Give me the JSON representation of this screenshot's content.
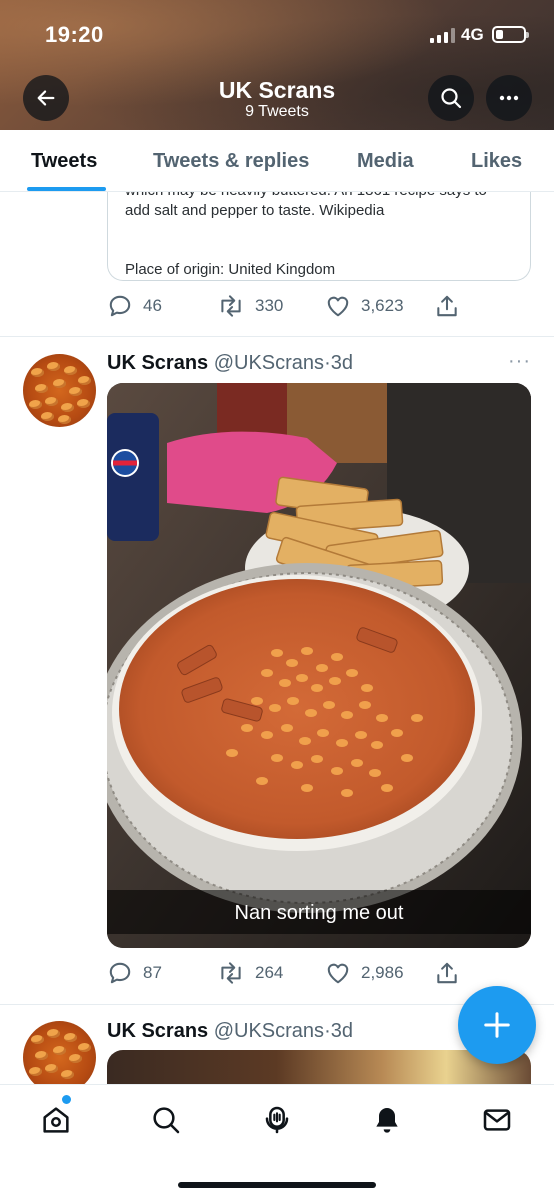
{
  "status_bar": {
    "time": "19:20",
    "network": "4G"
  },
  "header": {
    "title": "UK Scrans",
    "subtitle": "9 Tweets"
  },
  "tabs": [
    {
      "label": "Tweets",
      "active": true
    },
    {
      "label": "Tweets & replies",
      "active": false
    },
    {
      "label": "Media",
      "active": false
    },
    {
      "label": "Likes",
      "active": false
    }
  ],
  "tweet1": {
    "card": {
      "line1": "which may be heavily buttered. An 1861 recipe says to",
      "line2": "add salt and pepper to taste. Wikipedia",
      "line3": "Place of origin: United Kingdom"
    },
    "stats": {
      "replies": "46",
      "retweets": "330",
      "likes": "3,623"
    }
  },
  "tweet2": {
    "name": "UK Scrans",
    "handle": "@UKScrans",
    "time": "3d",
    "more": "···",
    "media_caption": "Nan sorting me out",
    "stats": {
      "replies": "87",
      "retweets": "264",
      "likes": "2,986"
    }
  },
  "tweet3": {
    "name": "UK Scrans",
    "handle": "@UKScrans",
    "time": "3d"
  },
  "icons": {
    "back": "arrow-left-icon",
    "search": "search-icon",
    "more": "more-icon",
    "reply": "reply-icon",
    "retweet": "retweet-icon",
    "like": "heart-icon",
    "share": "share-icon",
    "compose": "plus-icon",
    "nav": [
      "home-icon",
      "search-icon",
      "spaces-icon",
      "bell-icon",
      "mail-icon"
    ]
  },
  "colors": {
    "accent": "#1d9bf0",
    "text": "#0f1419",
    "muted": "#536471"
  }
}
